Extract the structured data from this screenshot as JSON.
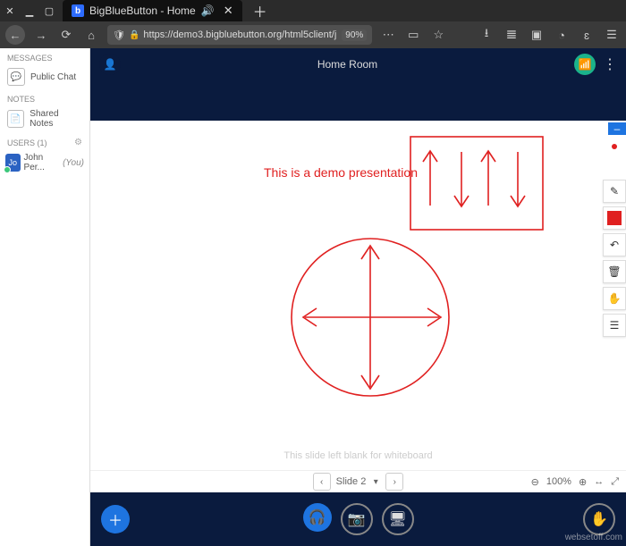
{
  "window": {
    "title": "BigBlueButton - Home",
    "speaker": "🔊"
  },
  "browser": {
    "url": "https://demo3.bigbluebutton.org/html5client/j",
    "zoom": "90%"
  },
  "sidebar": {
    "messages_head": "Messages",
    "public_chat": "Public Chat",
    "notes_head": "Notes",
    "shared_notes": "Shared Notes",
    "users_head": "Users (1)",
    "user": {
      "initials": "Jo",
      "name": "John Per...",
      "you": "(You)"
    }
  },
  "room": {
    "title": "Home Room"
  },
  "slide": {
    "demo_text": "This is a demo presentation",
    "watermark": "This slide left blank for whiteboard",
    "label": "Slide 2",
    "zoom": "100%"
  },
  "tools": {
    "pencil": "✎",
    "color": "■",
    "undo": "↶",
    "delete": "🗑",
    "hand": "✋",
    "annot": "☰"
  }
}
